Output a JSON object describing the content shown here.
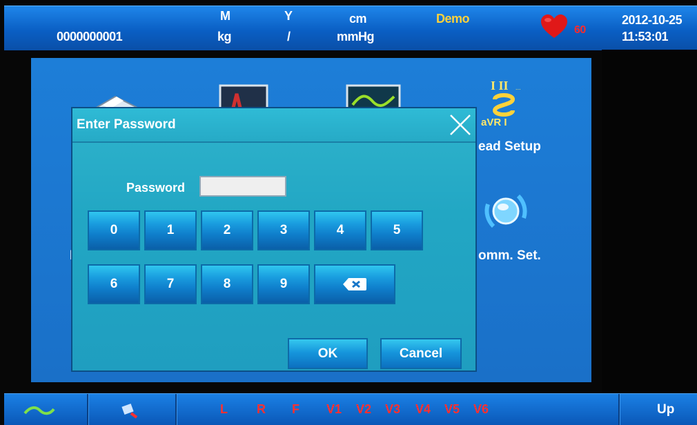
{
  "header": {
    "patient_id": "0000000001",
    "gender": "M",
    "age_unit": "Y",
    "height_unit": "cm",
    "weight_unit": "kg",
    "separator": "/",
    "bp_unit": "mmHg",
    "mode": "Demo",
    "heart_rate": "60",
    "date": "2012-10-25",
    "time": "11:53:01"
  },
  "main": {
    "lead_setup_label": "ead Setup",
    "comm_set_label": "omm. Set.",
    "hidden_label_left": "I"
  },
  "dialog": {
    "title": "Enter Password",
    "password_label": "Password",
    "password_value": "",
    "keys_row1": [
      "0",
      "1",
      "2",
      "3",
      "4",
      "5"
    ],
    "keys_row2": [
      "6",
      "7",
      "8",
      "9"
    ],
    "ok_label": "OK",
    "cancel_label": "Cancel"
  },
  "footer": {
    "leads": [
      "L",
      "R",
      "F",
      "V1",
      "V2",
      "V3",
      "V4",
      "V5",
      "V6"
    ],
    "up_label": "Up"
  },
  "colors": {
    "bar_blue": "#0a5fc4",
    "dialog_cyan": "#22a7c4",
    "demo_yellow": "#ffd23a",
    "alert_red": "#ff2a2a"
  },
  "icons": [
    "printer-icon",
    "ecg-monitor-icon",
    "waveform-icon",
    "lead-setup-icon",
    "communication-globe-icon",
    "heart-icon",
    "close-icon",
    "backspace-icon",
    "wave-icon",
    "tool-icon"
  ]
}
